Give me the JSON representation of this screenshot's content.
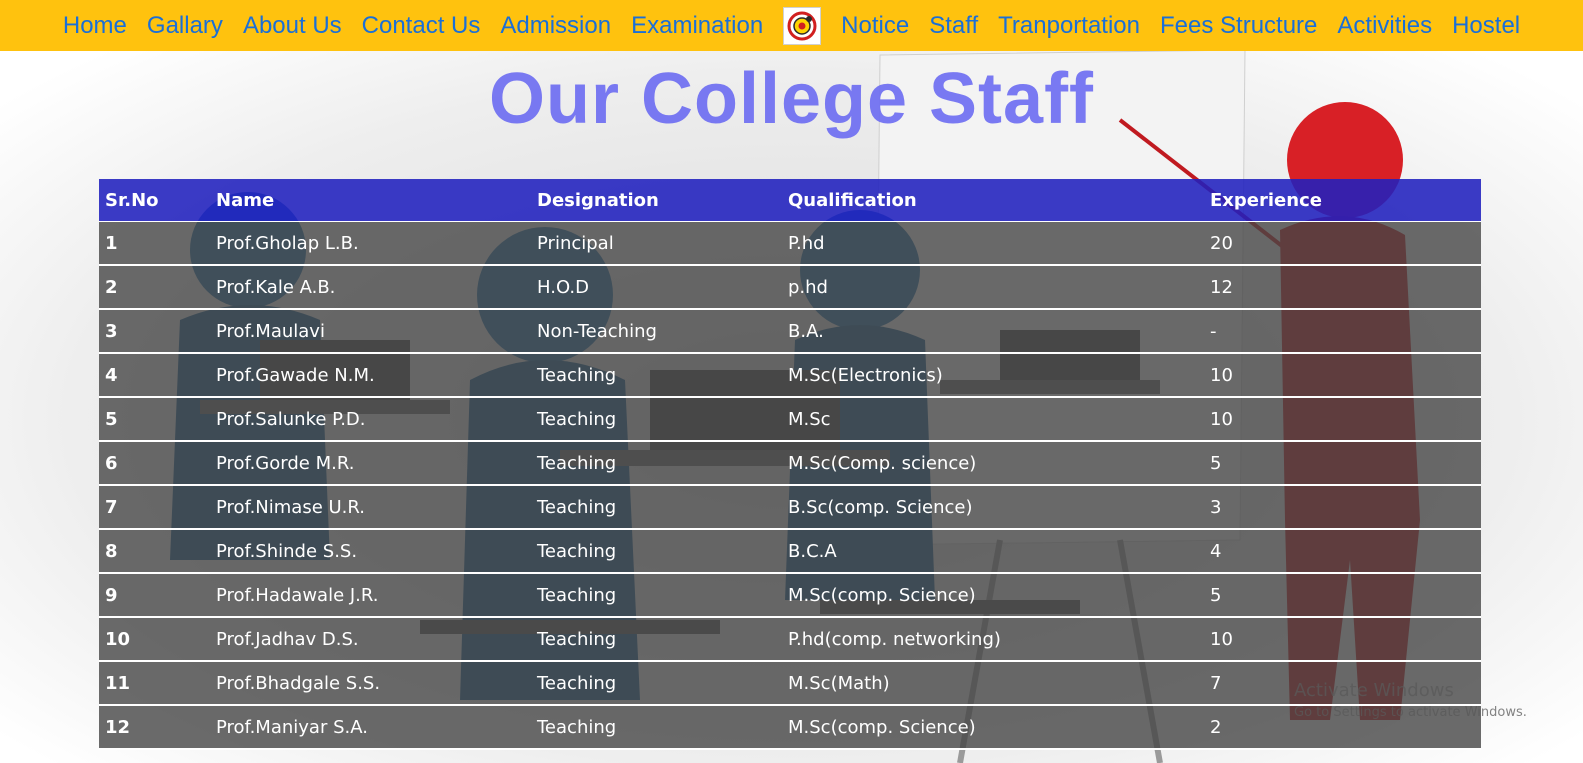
{
  "nav": {
    "items_left": [
      "Home",
      "Gallary",
      "About Us",
      "Contact Us",
      "Admission",
      "Examination"
    ],
    "logo_icon": "college-logo",
    "items_right": [
      "Notice",
      "Staff",
      "Tranportation",
      "Fees Structure",
      "Activities",
      "Hostel"
    ]
  },
  "title": "Our College Staff",
  "table": {
    "headers": [
      "Sr.No",
      "Name",
      "Designation",
      "Qualification",
      "Experience"
    ],
    "rows": [
      [
        "1",
        "Prof.Gholap L.B.",
        "Principal",
        "P.hd",
        "20"
      ],
      [
        "2",
        "Prof.Kale A.B.",
        "H.O.D",
        "p.hd",
        "12"
      ],
      [
        "3",
        "Prof.Maulavi",
        "Non-Teaching",
        "B.A.",
        "-"
      ],
      [
        "4",
        "Prof.Gawade N.M.",
        "Teaching",
        "M.Sc(Electronics)",
        "10"
      ],
      [
        "5",
        "Prof.Salunke P.D.",
        "Teaching",
        "M.Sc",
        "10"
      ],
      [
        "6",
        "Prof.Gorde M.R.",
        "Teaching",
        "M.Sc(Comp. science)",
        "5"
      ],
      [
        "7",
        "Prof.Nimase U.R.",
        "Teaching",
        "B.Sc(comp. Science)",
        "3"
      ],
      [
        "8",
        "Prof.Shinde S.S.",
        "Teaching",
        "B.C.A",
        "4"
      ],
      [
        "9",
        "Prof.Hadawale J.R.",
        "Teaching",
        "M.Sc(comp. Science)",
        "5"
      ],
      [
        "10",
        "Prof.Jadhav D.S.",
        "Teaching",
        "P.hd(comp. networking)",
        "10"
      ],
      [
        "11",
        "Prof.Bhadgale S.S.",
        "Teaching",
        "M.Sc(Math)",
        "7"
      ],
      [
        "12",
        "Prof.Maniyar S.A.",
        "Teaching",
        "M.Sc(comp. Science)",
        "2"
      ]
    ]
  },
  "watermark": {
    "line1": "Activate Windows",
    "line2": "Go to Settings to activate Windows."
  },
  "colors": {
    "navbar_bg": "#ffc20e",
    "nav_link": "#1a6fd8",
    "title": "#6f6ff2",
    "table_header_bg": "#2020be",
    "table_row_bg": "#464646"
  }
}
